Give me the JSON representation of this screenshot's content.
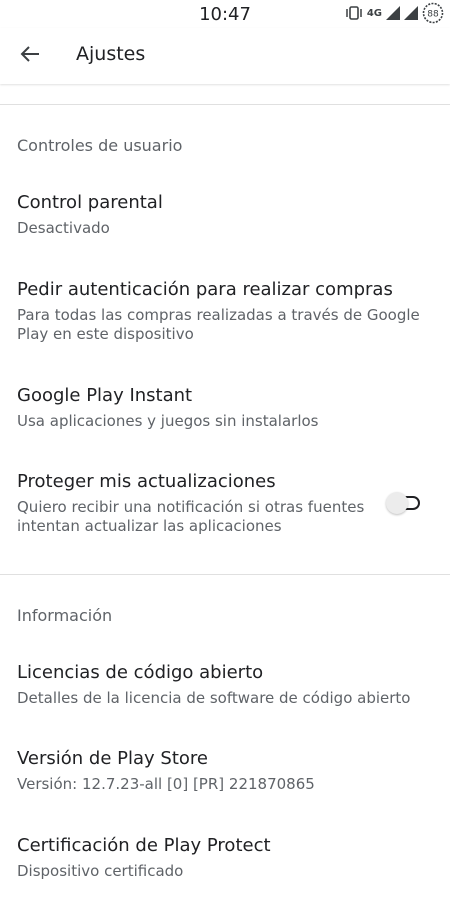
{
  "status_bar": {
    "time": "10:47",
    "network": "4G",
    "battery_level": "88"
  },
  "app_bar": {
    "title": "Ajustes"
  },
  "sections": [
    {
      "header": "Controles de usuario",
      "items": [
        {
          "title": "Control parental",
          "summary": "Desactivado"
        },
        {
          "title": "Pedir autenticación para realizar compras",
          "summary_lines": [
            "Para todas las compras realizadas a través de Google",
            "Play en este dispositivo"
          ]
        },
        {
          "title": "Google Play Instant",
          "summary": "Usa aplicaciones y juegos sin instalarlos"
        },
        {
          "title": "Proteger mis actualizaciones",
          "summary_lines": [
            "Quiero recibir una notificación si otras fuentes",
            "intentan actualizar las aplicaciones"
          ],
          "toggle_on": false
        }
      ]
    },
    {
      "header": "Información",
      "items": [
        {
          "title": "Licencias de código abierto",
          "summary": "Detalles de la licencia de software de código abierto"
        },
        {
          "title": "Versión de Play Store",
          "summary": "Versión: 12.7.23-all [0] [PR] 221870865"
        },
        {
          "title": "Certificación de Play Protect",
          "summary": "Dispositivo certificado"
        }
      ]
    }
  ]
}
